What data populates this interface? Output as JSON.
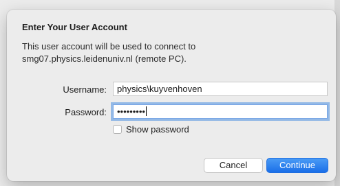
{
  "dialog": {
    "title": "Enter Your User Account",
    "description_line1": "This user account will be used to connect to",
    "description_line2": "smg07.physics.leidenuniv.nl (remote PC).",
    "username_label": "Username:",
    "username_value": "physics\\kuyvenhoven",
    "password_label": "Password:",
    "password_masked": "•••••••••",
    "show_password_label": "Show password",
    "show_password_checked": false,
    "cancel_label": "Cancel",
    "continue_label": "Continue"
  },
  "colors": {
    "accent": "#1a6fe8",
    "focus_ring": "#4a90e2",
    "background": "#ececec"
  }
}
